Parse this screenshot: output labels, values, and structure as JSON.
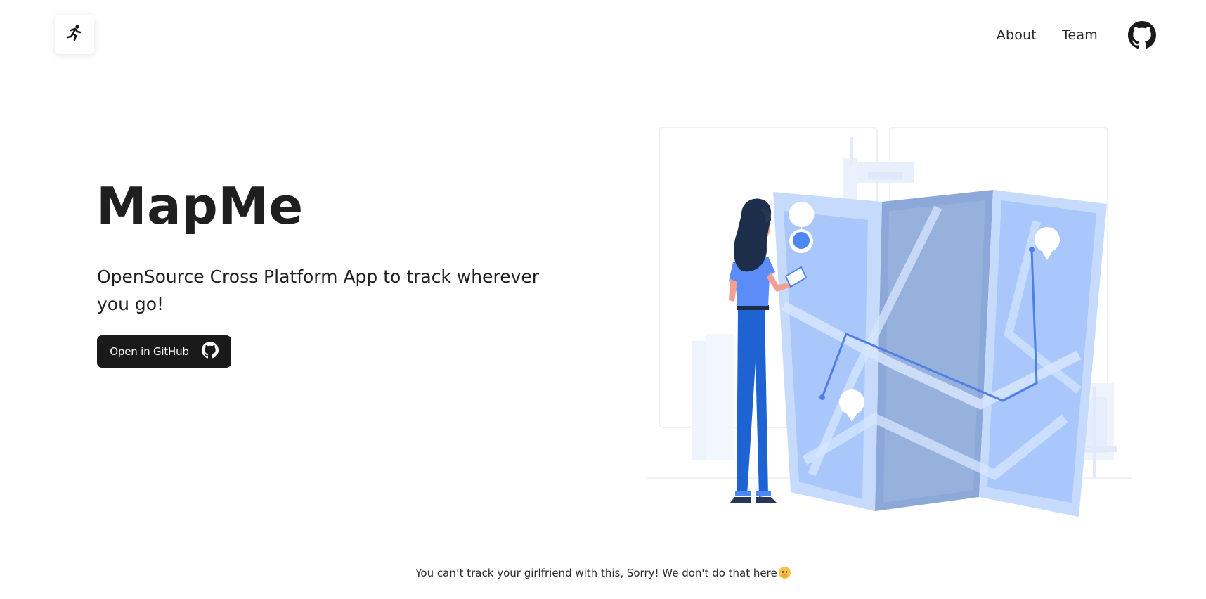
{
  "header": {
    "logo_icon": "runner-icon",
    "nav": [
      {
        "label": "About"
      },
      {
        "label": "Team"
      }
    ],
    "github_icon": "github-icon"
  },
  "hero": {
    "title": "MapMe",
    "subtitle": "OpenSource Cross Platform App to track wherever you go!",
    "button_label": "Open in GitHub",
    "button_icon": "github-icon",
    "illustration": "woman-reading-map-illustration"
  },
  "footer": {
    "text": "You can’t track your girlfriend with this, Sorry! We don't do that here",
    "emoji": "face-with-hand-over-mouth-emoji"
  },
  "colors": {
    "text": "#1f1f1f",
    "button_bg": "#1a1a1a",
    "accent_blue": "#5b8cf7",
    "light_blue": "#c9dcfb",
    "navy": "#263855"
  }
}
